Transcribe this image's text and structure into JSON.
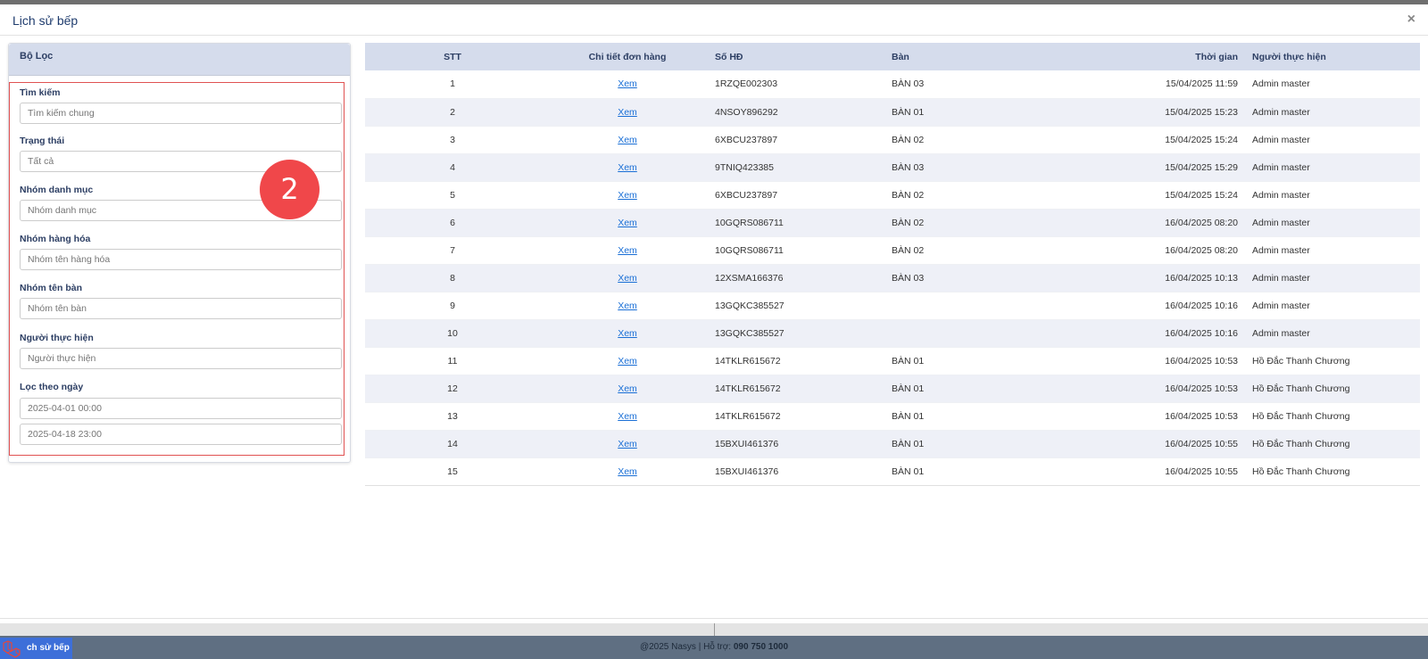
{
  "modal": {
    "title": "Lịch sử bếp",
    "close": "×"
  },
  "filter": {
    "header": "Bộ Lọc",
    "badge": "2",
    "search": {
      "label": "Tìm kiếm",
      "placeholder": "Tìm kiếm chung"
    },
    "status": {
      "label": "Trạng thái",
      "value": "Tất cả"
    },
    "category_group": {
      "label": "Nhóm danh mục",
      "placeholder": "Nhóm danh mục"
    },
    "product_group": {
      "label": "Nhóm hàng hóa",
      "placeholder": "Nhóm tên hàng hóa"
    },
    "table_group": {
      "label": "Nhóm tên bàn",
      "placeholder": "Nhóm tên bàn"
    },
    "performer": {
      "label": "Người thực hiện",
      "placeholder": "Người thực hiện"
    },
    "date_filter": {
      "label": "Lọc theo ngày",
      "from": "2025-04-01 00:00",
      "to": "2025-04-18 23:00"
    }
  },
  "table": {
    "headers": [
      "STT",
      "Chi tiết đơn hàng",
      "Số HĐ",
      "Bàn",
      "Thời gian",
      "Người thực hiện"
    ],
    "rows": [
      [
        "1",
        "Xem",
        "1RZQE002303",
        "BÀN 03",
        "15/04/2025 11:59",
        "Admin master"
      ],
      [
        "2",
        "Xem",
        "4NSOY896292",
        "BÀN 01",
        "15/04/2025 15:23",
        "Admin master"
      ],
      [
        "3",
        "Xem",
        "6XBCU237897",
        "BÀN 02",
        "15/04/2025 15:24",
        "Admin master"
      ],
      [
        "4",
        "Xem",
        "9TNIQ423385",
        "BÀN 03",
        "15/04/2025 15:29",
        "Admin master"
      ],
      [
        "5",
        "Xem",
        "6XBCU237897",
        "BÀN 02",
        "15/04/2025 15:24",
        "Admin master"
      ],
      [
        "6",
        "Xem",
        "10GQRS086711",
        "BÀN 02",
        "16/04/2025 08:20",
        "Admin master"
      ],
      [
        "7",
        "Xem",
        "10GQRS086711",
        "BÀN 02",
        "16/04/2025 08:20",
        "Admin master"
      ],
      [
        "8",
        "Xem",
        "12XSMA166376",
        "BÀN 03",
        "16/04/2025 10:13",
        "Admin master"
      ],
      [
        "9",
        "Xem",
        "13GQKC385527",
        "",
        "16/04/2025 10:16",
        "Admin master"
      ],
      [
        "10",
        "Xem",
        "13GQKC385527",
        "",
        "16/04/2025 10:16",
        "Admin master"
      ],
      [
        "11",
        "Xem",
        "14TKLR615672",
        "BÀN 01",
        "16/04/2025 10:53",
        "Hồ Đắc Thanh Chương"
      ],
      [
        "12",
        "Xem",
        "14TKLR615672",
        "BÀN 01",
        "16/04/2025 10:53",
        "Hồ Đắc Thanh Chương"
      ],
      [
        "13",
        "Xem",
        "14TKLR615672",
        "BÀN 01",
        "16/04/2025 10:53",
        "Hồ Đắc Thanh Chương"
      ],
      [
        "14",
        "Xem",
        "15BXUI461376",
        "BÀN 01",
        "16/04/2025 10:55",
        "Hồ Đắc Thanh Chương"
      ],
      [
        "15",
        "Xem",
        "15BXUI461376",
        "BÀN 01",
        "16/04/2025 10:55",
        "Hồ Đắc Thanh Chương"
      ]
    ]
  },
  "footer": {
    "copyright": "@2025 Nasys | Hỗ trợ:",
    "hotline": "090 750 1000",
    "tab_label": "ch sử bếp"
  },
  "colors": {
    "accent": "#3d6fd9",
    "badge": "#f0474a",
    "header_bg": "#d5dcec",
    "highlight_border": "#e05252",
    "link": "#1a6fd6"
  }
}
